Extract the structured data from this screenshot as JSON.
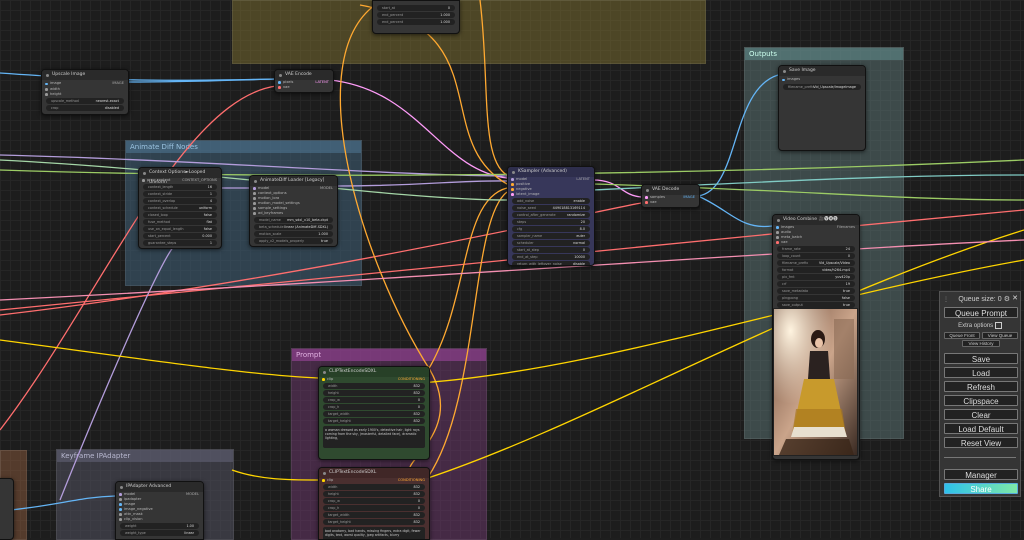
{
  "groups": {
    "top": "",
    "outputs": "Outputs",
    "animatediff": "Animate Diff Nodes",
    "prompt": "Prompt",
    "keyframe": "Keyframe IPAdapter"
  },
  "nodes": {
    "upscale": {
      "title": "Upscale Image",
      "in": [
        "image",
        "width",
        "height"
      ],
      "out": "IMAGE",
      "w1_label": "upscale_method",
      "w1_value": "nearest-exact",
      "w2_label": "crop",
      "w2_value": "disabled"
    },
    "vae_encode": {
      "title": "VAE Encode",
      "in": [
        "pixels",
        "vae"
      ],
      "out": "LATENT"
    },
    "top_small": {
      "rows": [
        [
          "start_at",
          "0"
        ],
        [
          "end_percent",
          "1.000"
        ],
        [
          "end_percent",
          "1.000"
        ]
      ]
    },
    "save_image": {
      "title": "Save Image",
      "in": "images",
      "w_label": "filename_prefix",
      "w_value": "Vid_Upscale/ImageImage"
    },
    "context": {
      "title": "Context Options►Looped Uniform",
      "in": "prev_context",
      "out": "CONTEXT_OPTIONS",
      "widgets": [
        [
          "context_length",
          "16"
        ],
        [
          "context_stride",
          "1"
        ],
        [
          "context_overlap",
          "4"
        ],
        [
          "context_schedule",
          "uniform"
        ],
        [
          "closed_loop",
          "false"
        ],
        [
          "fuse_method",
          "flat"
        ],
        [
          "use_on_equal_length",
          "false"
        ],
        [
          "start_percent",
          "0.000"
        ],
        [
          "guarantee_steps",
          "1"
        ]
      ]
    },
    "animatediff": {
      "title": "AnimateDiff Loader [Legacy]",
      "in": [
        "model",
        "context_options",
        "motion_lora",
        "motion_model_settings",
        "sample_settings",
        "ad_keyframes"
      ],
      "out": "MODEL",
      "widgets": [
        [
          "model_name",
          "mm_sdxl_v10_beta.ckpt"
        ],
        [
          "beta_schedule",
          "linear (AnimateDiff-SDXL)"
        ],
        [
          "motion_scale",
          "1.000"
        ],
        [
          "apply_v2_models_properly",
          "true"
        ]
      ]
    },
    "ksampler": {
      "title": "KSampler (Advanced)",
      "in": [
        "model",
        "positive",
        "negative",
        "latent_image"
      ],
      "out": "LATENT",
      "widgets": [
        [
          "add_noise",
          "enable"
        ],
        [
          "noise_seed",
          "449018813169114"
        ],
        [
          "control_after_generate",
          "randomize"
        ],
        [
          "steps",
          "20"
        ],
        [
          "cfg",
          "8.0"
        ],
        [
          "sampler_name",
          "euler"
        ],
        [
          "scheduler",
          "normal"
        ],
        [
          "start_at_step",
          "0"
        ],
        [
          "end_at_step",
          "10000"
        ],
        [
          "return_with_leftover_noise",
          "disable"
        ]
      ]
    },
    "vae_decode": {
      "title": "VAE Decode",
      "in": [
        "samples",
        "vae"
      ],
      "out": "IMAGE"
    },
    "video_combine": {
      "title": "Video Combine 🎥🅥🅗🅢",
      "in": [
        "images",
        "audio",
        "meta_batch",
        "vae"
      ],
      "out": "Filenames",
      "widgets": [
        [
          "frame_rate",
          "24"
        ],
        [
          "loop_count",
          "0"
        ],
        [
          "filename_prefix",
          "Vid_Upscale/Video"
        ],
        [
          "format",
          "video/h264-mp4"
        ],
        [
          "pix_fmt",
          "yuv420p"
        ],
        [
          "crf",
          "19"
        ],
        [
          "save_metadata",
          "true"
        ],
        [
          "pingpong",
          "false"
        ],
        [
          "save_output",
          "true"
        ]
      ]
    },
    "clip1": {
      "title": "CLIPTextEncodeSDXL",
      "in": "clip",
      "out": "CONDITIONING",
      "widgets": [
        [
          "width",
          "832"
        ],
        [
          "height",
          "832"
        ],
        [
          "crop_w",
          "0"
        ],
        [
          "crop_h",
          "0"
        ],
        [
          "target_width",
          "832"
        ],
        [
          "target_height",
          "832"
        ]
      ],
      "text": "a woman dressed as early 1900's, detective hair, light rays coming from the sky, (masterful, detailed face), dramatic lighting,"
    },
    "clip2": {
      "title": "CLIPTextEncodeSDXL",
      "in": "clip",
      "out": "CONDITIONING",
      "widgets": [
        [
          "width",
          "832"
        ],
        [
          "height",
          "832"
        ],
        [
          "crop_w",
          "0"
        ],
        [
          "crop_h",
          "0"
        ],
        [
          "target_width",
          "832"
        ],
        [
          "target_height",
          "832"
        ]
      ],
      "text": "bad anatomy, bad hands, missing fingers, extra digit, fewer digits, text, worst quality, jpeg artifacts, blurry"
    },
    "ipadapter": {
      "title": "IPAdapter Advanced",
      "in": [
        "model",
        "ipadapter",
        "image",
        "image_negative",
        "attn_mask",
        "clip_vision"
      ],
      "out": "MODEL",
      "widgets": [
        [
          "weight",
          "1.00"
        ],
        [
          "weight_type",
          "linear"
        ]
      ]
    }
  },
  "menu": {
    "queue_size": "Queue size: 0",
    "queue_prompt": "Queue Prompt",
    "extra_options": "Extra options",
    "queue_front": "Queue Front",
    "view_queue": "View Queue",
    "view_history": "View History",
    "save": "Save",
    "load": "Load",
    "refresh": "Refresh",
    "clipspace": "Clipspace",
    "clear": "Clear",
    "load_default": "Load Default",
    "reset_view": "Reset View",
    "manager": "Manager",
    "share": "Share"
  },
  "colors": {
    "wire_image": "#64b5f6",
    "wire_latent": "#ff9cf9",
    "wire_model": "#b39ddb",
    "wire_clip": "#ffd500",
    "wire_vae": "#ff6e6e",
    "wire_cond": "#ffa931",
    "share": "#2ec1ea"
  }
}
